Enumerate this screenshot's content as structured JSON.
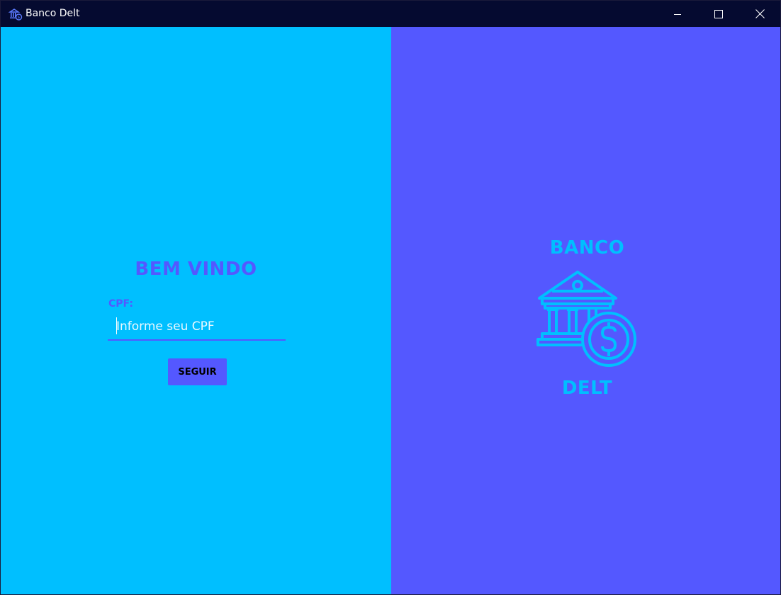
{
  "window": {
    "title": "Banco Delt",
    "app_icon": "bank-coin-icon",
    "controls": {
      "minimize": "minimize-icon",
      "maximize": "maximize-icon",
      "close": "close-icon"
    }
  },
  "login": {
    "heading": "BEM VINDO",
    "cpf_label": "CPF:",
    "cpf_placeholder": "Informe seu CPF",
    "cpf_value": "",
    "submit_label": "SEGUIR"
  },
  "brand": {
    "top_text": "BANCO",
    "bottom_text": "DELT",
    "logo_icon": "bank-building-dollar-icon"
  },
  "colors": {
    "titlebar": "#050a30",
    "left_panel": "#00bfff",
    "right_panel": "#5458ff",
    "accent": "#5458ff",
    "logo": "#00bfff"
  }
}
